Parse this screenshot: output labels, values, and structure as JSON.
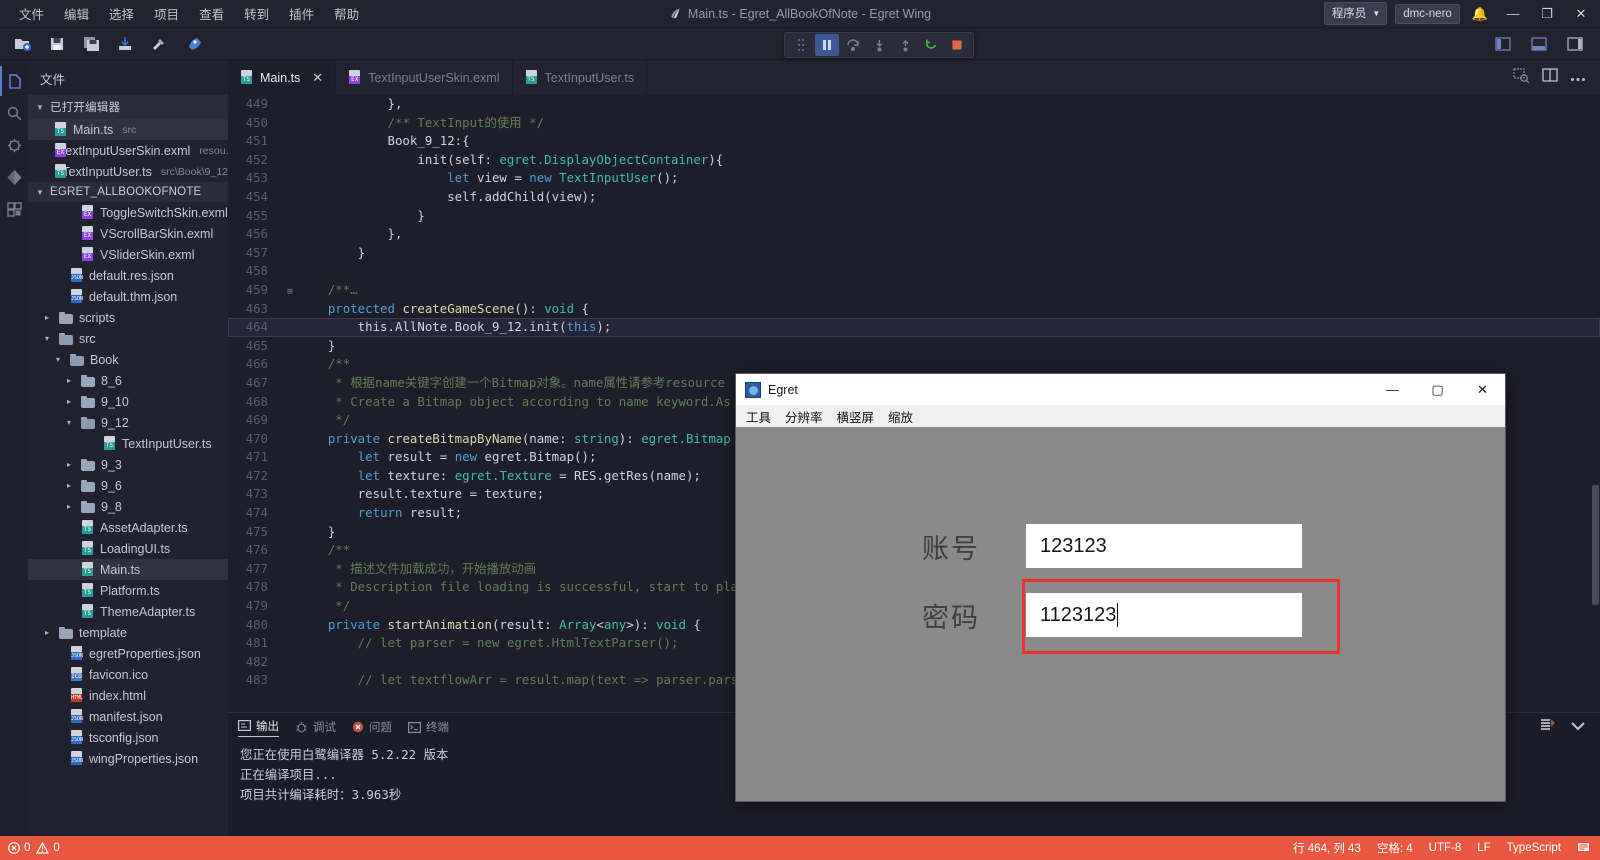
{
  "titlebar": {
    "menus": [
      "文件",
      "编辑",
      "选择",
      "项目",
      "查看",
      "转到",
      "插件",
      "帮助"
    ],
    "window_title": "Main.ts - Egret_AllBookOfNote - Egret Wing",
    "user_role": "程序员",
    "user_name": "dmc-nero",
    "minimize": "—",
    "maximize": "❐",
    "close": "✕"
  },
  "toolbar": {
    "buttons": [
      "new-project-icon",
      "save-icon",
      "save-all-icon",
      "import-icon",
      "build-icon",
      "run-icon"
    ],
    "layout_toggles": [
      "toggle-sidebar-icon",
      "toggle-panel-icon",
      "toggle-right-panel-icon"
    ]
  },
  "debug_toolbar": {
    "buttons": [
      "drag-handle",
      "pause",
      "step-over",
      "step-into",
      "step-out",
      "restart",
      "stop"
    ]
  },
  "activitybar": {
    "items": [
      "explorer-icon",
      "search-icon",
      "debug-icon",
      "source-control-icon",
      "extensions-icon"
    ]
  },
  "sidebar": {
    "title": "文件",
    "open_editors": {
      "label": "已打开编辑器",
      "items": [
        {
          "name": "Main.ts",
          "sub": "src",
          "type": "ts",
          "selected": true
        },
        {
          "name": "TextInputUserSkin.exml",
          "sub": "resou...",
          "type": "exml",
          "selected": false
        },
        {
          "name": "TextInputUser.ts",
          "sub": "src\\Book\\9_12",
          "type": "ts",
          "selected": false
        }
      ]
    },
    "project": {
      "label": "EGRET_ALLBOOKOFNOTE",
      "items": [
        {
          "name": "ToggleSwitchSkin.exml",
          "type": "exml",
          "indent": 3
        },
        {
          "name": "VScrollBarSkin.exml",
          "type": "exml",
          "indent": 3
        },
        {
          "name": "VSliderSkin.exml",
          "type": "exml",
          "indent": 3
        },
        {
          "name": "default.res.json",
          "type": "json",
          "indent": 2
        },
        {
          "name": "default.thm.json",
          "type": "json",
          "indent": 2
        },
        {
          "name": "scripts",
          "type": "folder",
          "indent": 1,
          "arrow": "▸"
        },
        {
          "name": "src",
          "type": "folder-open",
          "indent": 1,
          "arrow": "▾"
        },
        {
          "name": "Book",
          "type": "folder-open",
          "indent": 2,
          "arrow": "▾"
        },
        {
          "name": "8_6",
          "type": "folder",
          "indent": 3,
          "arrow": "▸"
        },
        {
          "name": "9_10",
          "type": "folder",
          "indent": 3,
          "arrow": "▸"
        },
        {
          "name": "9_12",
          "type": "folder-open",
          "indent": 3,
          "arrow": "▾"
        },
        {
          "name": "TextInputUser.ts",
          "type": "ts",
          "indent": 5
        },
        {
          "name": "9_3",
          "type": "folder",
          "indent": 3,
          "arrow": "▸"
        },
        {
          "name": "9_6",
          "type": "folder",
          "indent": 3,
          "arrow": "▸"
        },
        {
          "name": "9_8",
          "type": "folder",
          "indent": 3,
          "arrow": "▸"
        },
        {
          "name": "AssetAdapter.ts",
          "type": "ts",
          "indent": 3
        },
        {
          "name": "LoadingUI.ts",
          "type": "ts",
          "indent": 3
        },
        {
          "name": "Main.ts",
          "type": "ts",
          "indent": 3,
          "selected": true
        },
        {
          "name": "Platform.ts",
          "type": "ts",
          "indent": 3
        },
        {
          "name": "ThemeAdapter.ts",
          "type": "ts",
          "indent": 3
        },
        {
          "name": "template",
          "type": "folder",
          "indent": 1,
          "arrow": "▸"
        },
        {
          "name": "egretProperties.json",
          "type": "json",
          "indent": 2
        },
        {
          "name": "favicon.ico",
          "type": "ico-file",
          "indent": 2
        },
        {
          "name": "index.html",
          "type": "html",
          "indent": 2
        },
        {
          "name": "manifest.json",
          "type": "json",
          "indent": 2
        },
        {
          "name": "tsconfig.json",
          "type": "json",
          "indent": 2
        },
        {
          "name": "wingProperties.json",
          "type": "json",
          "indent": 2
        }
      ]
    }
  },
  "editor": {
    "tabs": [
      {
        "label": "Main.ts",
        "type": "ts",
        "active": true,
        "closable": true
      },
      {
        "label": "TextInputUserSkin.exml",
        "type": "exml",
        "active": false
      },
      {
        "label": "TextInputUser.ts",
        "type": "ts",
        "active": false
      }
    ],
    "tab_actions": [
      "preview-icon",
      "split-editor-icon",
      "more-actions-icon"
    ],
    "lines": [
      {
        "n": "449",
        "fold": "",
        "hl": false,
        "tokens": [
          {
            "t": "            },",
            "c": "pl"
          }
        ]
      },
      {
        "n": "450",
        "fold": "",
        "hl": false,
        "tokens": [
          {
            "t": "            /** TextInput的使用 */",
            "c": "cm"
          }
        ]
      },
      {
        "n": "451",
        "fold": "",
        "hl": false,
        "tokens": [
          {
            "t": "            Book_9_12",
            "c": "pl"
          },
          {
            "t": ":{",
            "c": "pl"
          }
        ]
      },
      {
        "n": "452",
        "fold": "",
        "hl": false,
        "tokens": [
          {
            "t": "                init(self: ",
            "c": "pl"
          },
          {
            "t": "egret.DisplayObjectContainer",
            "c": "ty"
          },
          {
            "t": "){",
            "c": "pl"
          }
        ]
      },
      {
        "n": "453",
        "fold": "",
        "hl": false,
        "tokens": [
          {
            "t": "                    ",
            "c": "pl"
          },
          {
            "t": "let",
            "c": "kw"
          },
          {
            "t": " view = ",
            "c": "pl"
          },
          {
            "t": "new",
            "c": "kw"
          },
          {
            "t": " ",
            "c": "pl"
          },
          {
            "t": "TextInputUser",
            "c": "ty"
          },
          {
            "t": "();",
            "c": "pl"
          }
        ]
      },
      {
        "n": "454",
        "fold": "",
        "hl": false,
        "tokens": [
          {
            "t": "                    self.addChild(view);",
            "c": "pl"
          }
        ]
      },
      {
        "n": "455",
        "fold": "",
        "hl": false,
        "tokens": [
          {
            "t": "                }",
            "c": "pl"
          }
        ]
      },
      {
        "n": "456",
        "fold": "",
        "hl": false,
        "tokens": [
          {
            "t": "            },",
            "c": "pl"
          }
        ]
      },
      {
        "n": "457",
        "fold": "",
        "hl": false,
        "tokens": [
          {
            "t": "        }",
            "c": "pl"
          }
        ]
      },
      {
        "n": "458",
        "fold": "",
        "hl": false,
        "tokens": [
          {
            "t": "",
            "c": "pl"
          }
        ]
      },
      {
        "n": "459",
        "fold": "⊞",
        "hl": false,
        "tokens": [
          {
            "t": "    /**…",
            "c": "cm"
          }
        ]
      },
      {
        "n": "463",
        "fold": "",
        "hl": false,
        "tokens": [
          {
            "t": "    ",
            "c": "pl"
          },
          {
            "t": "protected",
            "c": "kw"
          },
          {
            "t": " ",
            "c": "pl"
          },
          {
            "t": "createGameScene",
            "c": "fn"
          },
          {
            "t": "(): ",
            "c": "pl"
          },
          {
            "t": "void",
            "c": "ty"
          },
          {
            "t": " {",
            "c": "pl"
          }
        ]
      },
      {
        "n": "464",
        "fold": "",
        "hl": true,
        "tokens": [
          {
            "t": "        this.AllNote.Book_9_12.init(",
            "c": "pl"
          },
          {
            "t": "this",
            "c": "kw"
          },
          {
            "t": ");",
            "c": "pl"
          }
        ]
      },
      {
        "n": "465",
        "fold": "",
        "hl": false,
        "tokens": [
          {
            "t": "    }",
            "c": "pl"
          }
        ]
      },
      {
        "n": "466",
        "fold": "",
        "hl": false,
        "tokens": [
          {
            "t": "    /**",
            "c": "cm"
          }
        ]
      },
      {
        "n": "467",
        "fold": "",
        "hl": false,
        "tokens": [
          {
            "t": "     * 根据name关键字创建一个Bitmap对象。name属性请参考resource",
            "c": "cm"
          }
        ]
      },
      {
        "n": "468",
        "fold": "",
        "hl": false,
        "tokens": [
          {
            "t": "     * Create a Bitmap object according to name keyword.As",
            "c": "cm"
          }
        ]
      },
      {
        "n": "469",
        "fold": "",
        "hl": false,
        "tokens": [
          {
            "t": "     */",
            "c": "cm"
          }
        ]
      },
      {
        "n": "470",
        "fold": "",
        "hl": false,
        "tokens": [
          {
            "t": "    ",
            "c": "pl"
          },
          {
            "t": "private",
            "c": "kw"
          },
          {
            "t": " ",
            "c": "pl"
          },
          {
            "t": "createBitmapByName",
            "c": "fn"
          },
          {
            "t": "(name: ",
            "c": "pl"
          },
          {
            "t": "string",
            "c": "ty"
          },
          {
            "t": "): ",
            "c": "pl"
          },
          {
            "t": "egret.Bitmap",
            "c": "ty"
          }
        ]
      },
      {
        "n": "471",
        "fold": "",
        "hl": false,
        "tokens": [
          {
            "t": "        ",
            "c": "pl"
          },
          {
            "t": "let",
            "c": "kw"
          },
          {
            "t": " result = ",
            "c": "pl"
          },
          {
            "t": "new",
            "c": "kw"
          },
          {
            "t": " egret.Bitmap();",
            "c": "pl"
          }
        ]
      },
      {
        "n": "472",
        "fold": "",
        "hl": false,
        "tokens": [
          {
            "t": "        ",
            "c": "pl"
          },
          {
            "t": "let",
            "c": "kw"
          },
          {
            "t": " texture: ",
            "c": "pl"
          },
          {
            "t": "egret.Texture",
            "c": "ty"
          },
          {
            "t": " = RES.getRes(name);",
            "c": "pl"
          }
        ]
      },
      {
        "n": "473",
        "fold": "",
        "hl": false,
        "tokens": [
          {
            "t": "        result.texture = texture;",
            "c": "pl"
          }
        ]
      },
      {
        "n": "474",
        "fold": "",
        "hl": false,
        "tokens": [
          {
            "t": "        ",
            "c": "pl"
          },
          {
            "t": "return",
            "c": "kw"
          },
          {
            "t": " result;",
            "c": "pl"
          }
        ]
      },
      {
        "n": "475",
        "fold": "",
        "hl": false,
        "tokens": [
          {
            "t": "    }",
            "c": "pl"
          }
        ]
      },
      {
        "n": "476",
        "fold": "",
        "hl": false,
        "tokens": [
          {
            "t": "    /**",
            "c": "cm"
          }
        ]
      },
      {
        "n": "477",
        "fold": "",
        "hl": false,
        "tokens": [
          {
            "t": "     * 描述文件加载成功，开始播放动画",
            "c": "cm"
          }
        ]
      },
      {
        "n": "478",
        "fold": "",
        "hl": false,
        "tokens": [
          {
            "t": "     * Description file loading is successful, start to pla",
            "c": "cm"
          }
        ]
      },
      {
        "n": "479",
        "fold": "",
        "hl": false,
        "tokens": [
          {
            "t": "     */",
            "c": "cm"
          }
        ]
      },
      {
        "n": "480",
        "fold": "",
        "hl": false,
        "tokens": [
          {
            "t": "    ",
            "c": "pl"
          },
          {
            "t": "private",
            "c": "kw"
          },
          {
            "t": " ",
            "c": "pl"
          },
          {
            "t": "startAnimation",
            "c": "fn"
          },
          {
            "t": "(result: ",
            "c": "pl"
          },
          {
            "t": "Array",
            "c": "ty"
          },
          {
            "t": "<",
            "c": "pl"
          },
          {
            "t": "any",
            "c": "ty"
          },
          {
            "t": ">): ",
            "c": "pl"
          },
          {
            "t": "void",
            "c": "ty"
          },
          {
            "t": " {",
            "c": "pl"
          }
        ]
      },
      {
        "n": "481",
        "fold": "",
        "hl": false,
        "tokens": [
          {
            "t": "        // let parser = new egret.HtmlTextParser();",
            "c": "cm"
          }
        ]
      },
      {
        "n": "482",
        "fold": "",
        "hl": false,
        "tokens": [
          {
            "t": "",
            "c": "pl"
          }
        ]
      },
      {
        "n": "483",
        "fold": "",
        "hl": false,
        "tokens": [
          {
            "t": "        // let textflowArr = result.map(text => parser.pars",
            "c": "cm"
          }
        ]
      }
    ]
  },
  "panel": {
    "tabs": [
      {
        "label": "输出",
        "icon": "output-icon",
        "active": true
      },
      {
        "label": "调试",
        "icon": "debug-console-icon",
        "active": false
      },
      {
        "label": "问题",
        "icon": "problems-icon",
        "active": false
      },
      {
        "label": "终端",
        "icon": "terminal-icon",
        "active": false
      }
    ],
    "actions": [
      "clear-output-icon",
      "collapse-panel-icon"
    ],
    "output_lines": [
      "您正在使用白鹭编译器 5.2.22 版本",
      "正在编译项目...",
      "项目共计编译耗时：3.963秒"
    ]
  },
  "statusbar": {
    "errors": "0",
    "warnings": "0",
    "cursor": "行 464, 列 43",
    "indent": "空格: 4",
    "encoding": "UTF-8",
    "eol": "LF",
    "language": "TypeScript",
    "feedback": "bell-icon",
    "background": "#e8573f"
  },
  "egret_window": {
    "title": "Egret",
    "minimize": "—",
    "maximize": "▢",
    "close": "✕",
    "menus": [
      "工具",
      "分辨率",
      "横竖屏",
      "缩放"
    ],
    "form": {
      "account_label": "账号",
      "account_value": "123123",
      "password_label": "密码",
      "password_value": "1123123",
      "focus_color": "#e8332a",
      "canvas_color": "#8a8a8a"
    }
  }
}
